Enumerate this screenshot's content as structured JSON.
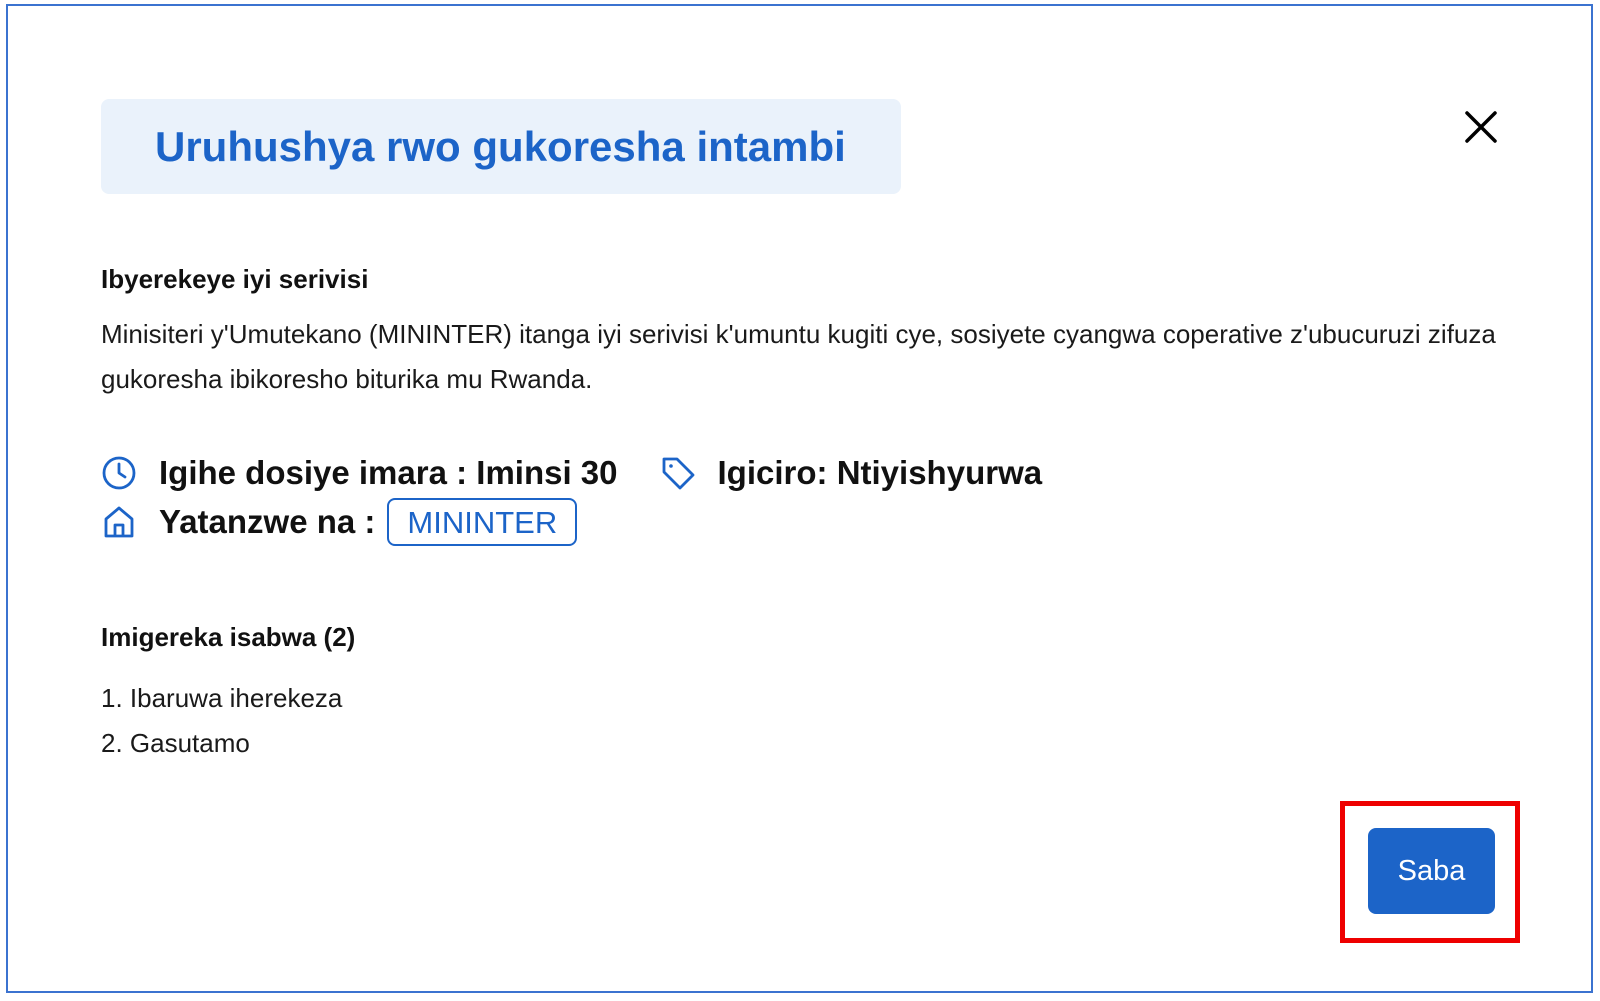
{
  "modal": {
    "title": "Uruhushya rwo gukoresha intambi",
    "close_icon": "close-icon"
  },
  "about": {
    "heading": "Ibyerekeye iyi serivisi",
    "description": "Minisiteri y'Umutekano (MININTER) itanga iyi serivisi k'umuntu kugiti cye, sosiyete cyangwa coperative z'ubucuruzi zifuza gukoresha ibikoresho biturika mu Rwanda."
  },
  "meta": {
    "processing_time": "Igihe dosiye imara : Iminsi 30",
    "processing_icon": "clock-icon",
    "price": "Igiciro: Ntiyishyurwa",
    "price_icon": "price-tag-icon",
    "provider_label": "Yatanzwe na :",
    "provider_icon": "home-icon",
    "provider_badge": "MININTER"
  },
  "requirements": {
    "heading": "Imigereka isabwa (2)",
    "items": [
      "1. Ibaruwa iherekeza",
      "2. Gasutamo"
    ]
  },
  "actions": {
    "apply_label": "Saba"
  },
  "colors": {
    "accent": "#1c64c8",
    "title_bg": "#eaf2fb",
    "frame_border": "#3b73d0",
    "highlight": "#ee0000"
  }
}
